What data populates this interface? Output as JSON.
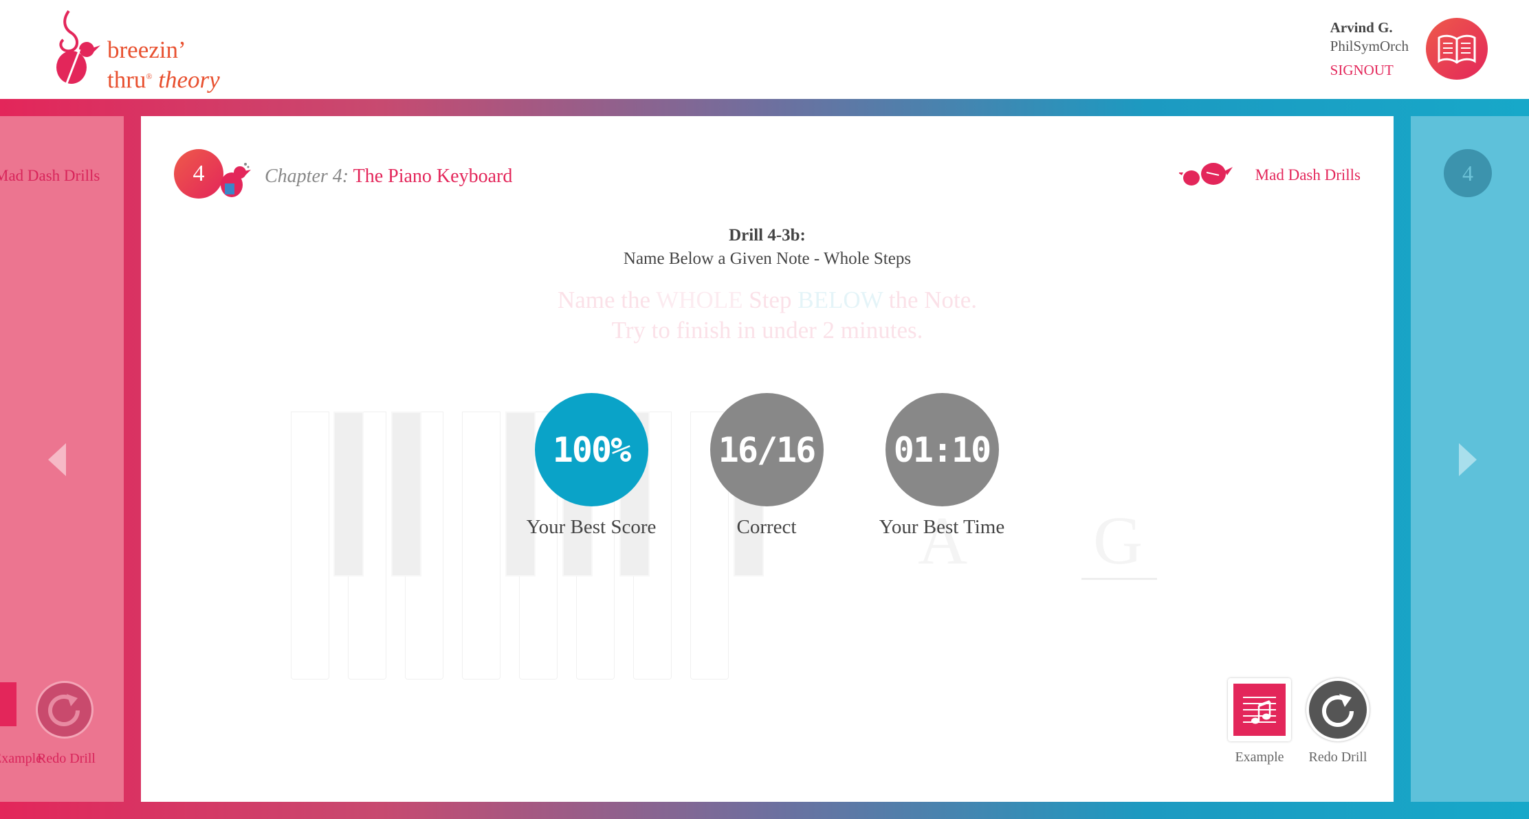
{
  "brand": {
    "line1": "breezin’",
    "line2_plain": "thru",
    "reg": "®",
    "line2_italic": "theory"
  },
  "user": {
    "name": "Arvind G.",
    "org": "PhilSymOrch",
    "signout_label": "SIGNOUT"
  },
  "icons": {
    "book": "book-icon",
    "bird": "bird-icon",
    "staff": "music-staff-icon",
    "redo": "redo-icon"
  },
  "colors": {
    "accent": "#e3265a",
    "brand_orange": "#e8502f",
    "score_circle": "#0aa3c8",
    "neutral_circle": "#888888"
  },
  "prev_panel": {
    "title": "Mad Dash Drills",
    "example_label": "Example",
    "redo_label": "Redo Drill"
  },
  "next_panel": {
    "chapter_number": "4"
  },
  "chapter": {
    "number": "4",
    "prefix": "Chapter 4:",
    "name": "The Piano Keyboard"
  },
  "section_link": "Mad Dash Drills",
  "drill": {
    "title": "Drill 4-3b:",
    "subtitle": "Name Below a Given Note - Whole Steps",
    "instr_part1": "Name the ",
    "instr_whole": "WHOLE",
    "instr_part2": " Step ",
    "instr_below": "BELOW",
    "instr_part3": " the Note.",
    "instr_line2": "Try to finish in under 2 minutes."
  },
  "faded_answer": {
    "left": "A",
    "right": "G"
  },
  "stats": {
    "best_score": {
      "value": "100%",
      "label": "Your Best Score"
    },
    "correct": {
      "value": "16/16",
      "label": "Correct"
    },
    "best_time": {
      "value": "01:10",
      "label": "Your Best Time"
    }
  },
  "buttons": {
    "example_label": "Example",
    "redo_label": "Redo Drill"
  }
}
